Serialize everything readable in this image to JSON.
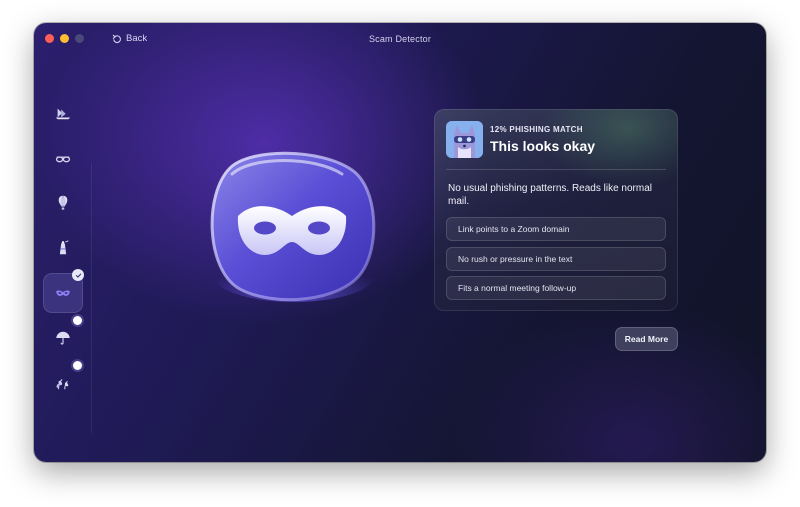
{
  "window": {
    "title": "Scam Detector"
  },
  "nav": {
    "back_label": "Back"
  },
  "sidebar": {
    "items": [
      {
        "name": "ships-icon",
        "state": "normal"
      },
      {
        "name": "glasses-icon",
        "state": "normal"
      },
      {
        "name": "hot-air-balloon-icon",
        "state": "normal"
      },
      {
        "name": "lighthouse-icon",
        "state": "normal"
      },
      {
        "name": "mask-icon",
        "state": "active-checked"
      },
      {
        "name": "umbrella-icon",
        "state": "new"
      },
      {
        "name": "plants-icon",
        "state": "new"
      }
    ]
  },
  "result": {
    "match_label": "12% PHISHING MATCH",
    "match_percent": 12,
    "headline": "This looks okay",
    "description": "No usual phishing patterns. Reads like normal mail.",
    "reasons": [
      "Link points to a Zoom domain",
      "No rush or pressure in the text",
      "Fits a normal meeting follow-up"
    ],
    "read_more_label": "Read More"
  },
  "colors": {
    "accent": "#7a6cf0",
    "bg_dark": "#141531",
    "close": "#ff5f57",
    "minimize": "#febc2e"
  }
}
